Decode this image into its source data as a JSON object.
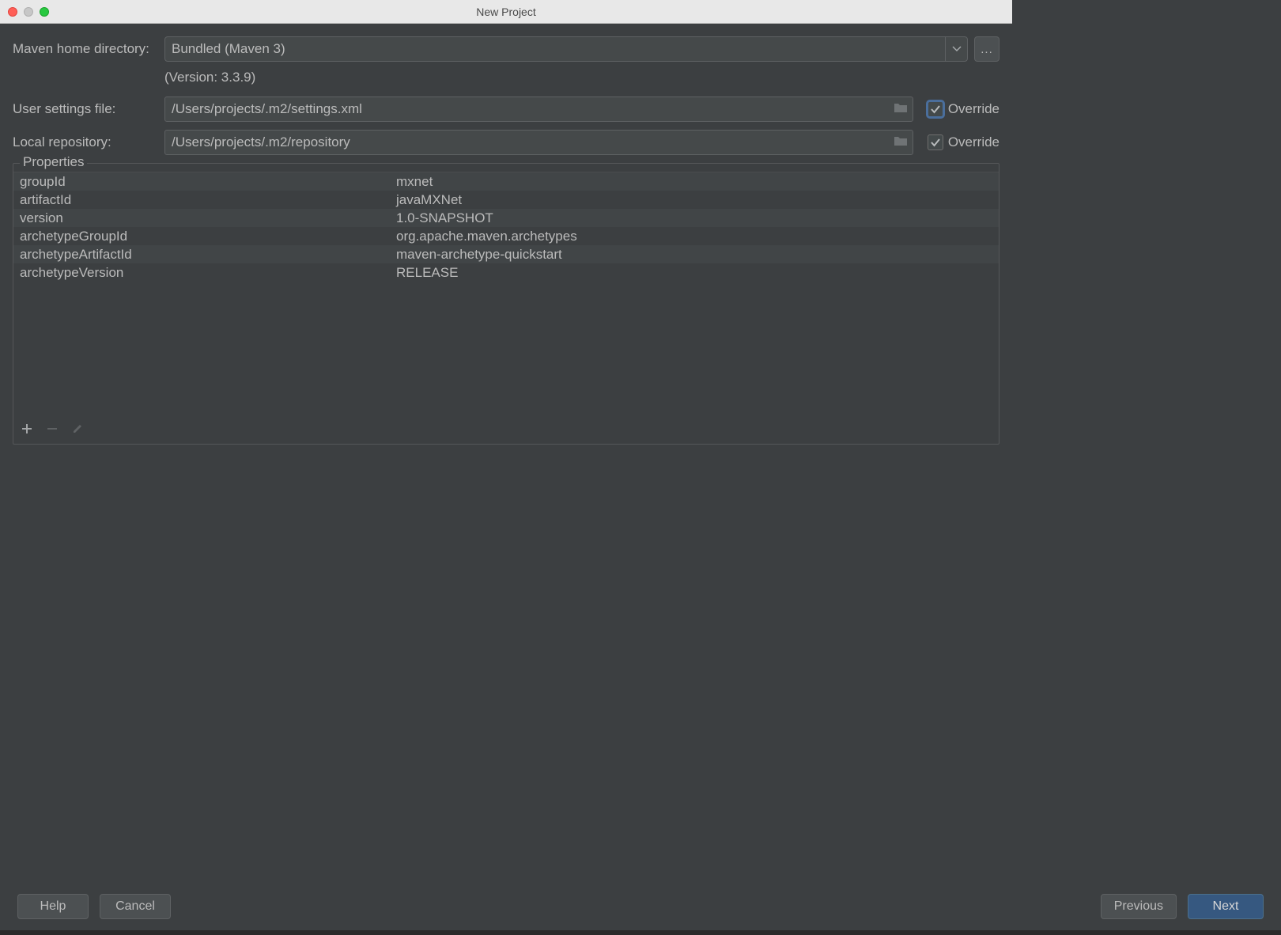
{
  "window": {
    "title": "New Project"
  },
  "mavenHome": {
    "label": "Maven home directory:",
    "value": "Bundled (Maven 3)",
    "more": "...",
    "versionNote": "(Version: 3.3.9)"
  },
  "userSettings": {
    "label": "User settings file:",
    "value": "/Users/projects/.m2/settings.xml",
    "override": "Override",
    "checked": true
  },
  "localRepo": {
    "label": "Local repository:",
    "value": "/Users/projects/.m2/repository",
    "override": "Override",
    "checked": true
  },
  "properties": {
    "legend": "Properties",
    "rows": [
      {
        "key": "groupId",
        "val": "mxnet"
      },
      {
        "key": "artifactId",
        "val": "javaMXNet"
      },
      {
        "key": "version",
        "val": "1.0-SNAPSHOT"
      },
      {
        "key": "archetypeGroupId",
        "val": "org.apache.maven.archetypes"
      },
      {
        "key": "archetypeArtifactId",
        "val": "maven-archetype-quickstart"
      },
      {
        "key": "archetypeVersion",
        "val": "RELEASE"
      }
    ]
  },
  "buttons": {
    "help": "Help",
    "cancel": "Cancel",
    "previous": "Previous",
    "next": "Next"
  }
}
